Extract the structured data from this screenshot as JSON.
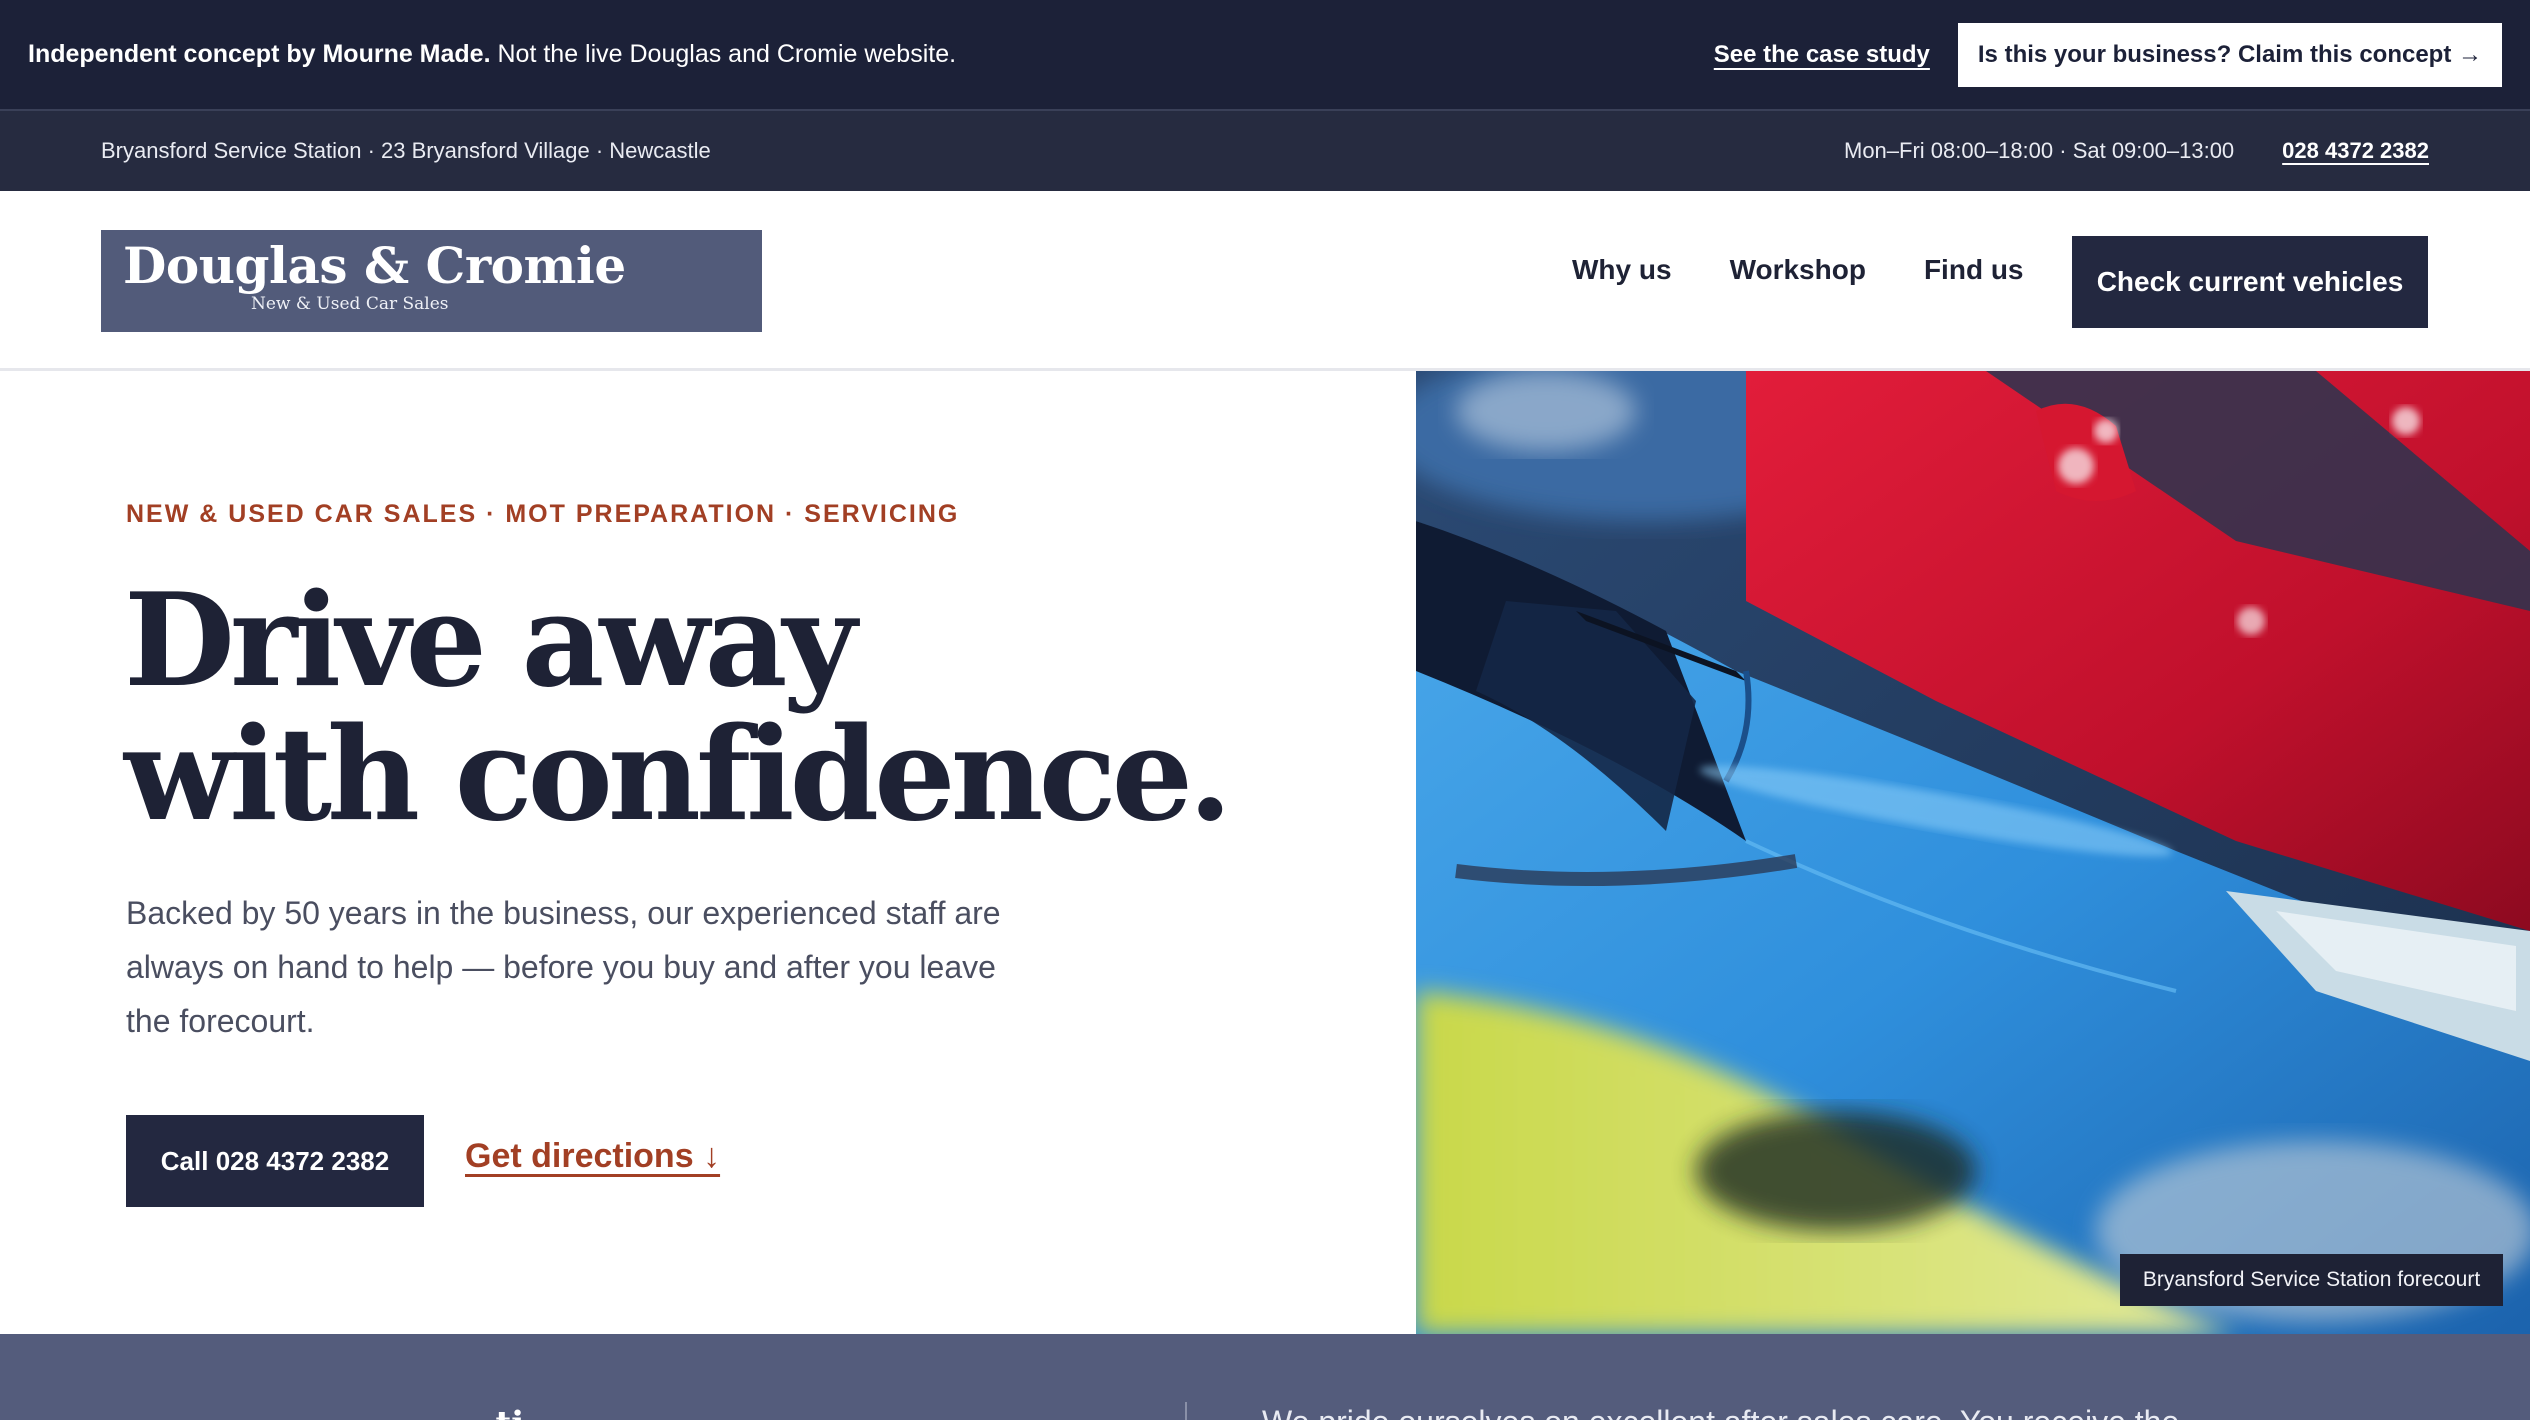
{
  "concept_bar": {
    "label_strong": "Independent concept by Mourne Made.",
    "label_rest": "Not the live Douglas and Cromie website.",
    "case_study_link": "See the case study",
    "claim_button": "Is this your business? Claim this concept →"
  },
  "info_bar": {
    "address": "Bryansford Service Station · 23 Bryansford Village · Newcastle",
    "hours": "Mon–Fri 08:00–18:00 · Sat 09:00–13:00",
    "phone": "028 4372 2382"
  },
  "header": {
    "logo_name": "Douglas & Cromie",
    "logo_tagline": "New & Used Car Sales",
    "nav": [
      {
        "label": "Why us"
      },
      {
        "label": "Workshop"
      },
      {
        "label": "Find us"
      }
    ],
    "cta": "Check current vehicles"
  },
  "hero": {
    "eyebrow": "NEW & USED CAR SALES · MOT PREPARATION · SERVICING",
    "headline_line1": "Drive away",
    "headline_line2": "with confidence.",
    "body": "Backed by 50 years in the business, our experienced staff are always on hand to help — before you buy and after you leave the forecourt.",
    "call_button": "Call 028 4372 2382",
    "directions_link": "Get directions ↓",
    "photo_caption": "Bryansford Service Station forecourt"
  },
  "lower": {
    "heading": "...ti...",
    "text": "We pride ourselves on excellent after sales care. You receive the"
  },
  "colors": {
    "navy": "#1c2138",
    "slate": "#525b7a",
    "accent_rust": "#a23f24"
  }
}
